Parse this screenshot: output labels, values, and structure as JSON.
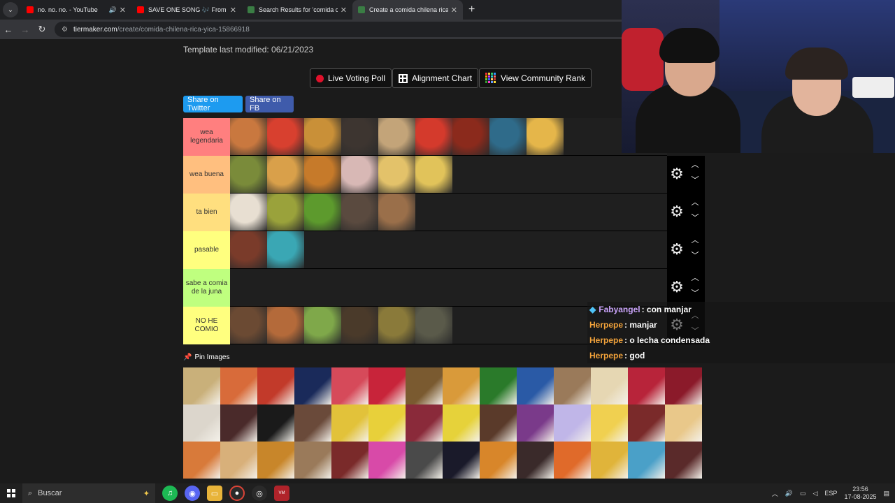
{
  "browser": {
    "tabs": [
      {
        "title": "no. no. no. - YouTube",
        "fav_color": "#ff0000",
        "active": false,
        "audio": true
      },
      {
        "title": "SAVE ONE SONG 🎶 From A to",
        "fav_color": "#ff0000",
        "active": false,
        "audio": false
      },
      {
        "title": "Search Results for 'comida chile",
        "fav_color": "#3a7d44",
        "active": false,
        "audio": false
      },
      {
        "title": "Create a comida chilena rica yica",
        "fav_color": "#3a7d44",
        "active": true,
        "audio": false
      }
    ],
    "url_host": "tiermaker.com",
    "url_path": "/create/comida-chilena-rica-yica-15866918"
  },
  "page": {
    "modified": "Template last modified: 06/21/2023",
    "buttons": {
      "live_poll": "Live Voting Poll",
      "alignment": "Alignment Chart",
      "community": "View Community Rank",
      "share_twitter": "Share on Twitter",
      "share_fb": "Share on FB"
    },
    "pin_images": "Pin Images"
  },
  "tiers": [
    {
      "label": "wea legendaria",
      "color": "#ff7f7f",
      "items": [
        "#c9783f",
        "#d8402f",
        "#c99038",
        "#3d3530",
        "#c3a479",
        "#d43a2c",
        "#8b2a1c",
        "#2f6b8a",
        "#e5b64a"
      ]
    },
    {
      "label": "wea buena",
      "color": "#ffbf7f",
      "items": [
        "#7a8b3a",
        "#d9a04a",
        "#c67a2a",
        "#d8b8b5",
        "#e3c26a",
        "#e1c35a"
      ]
    },
    {
      "label": "ta bien",
      "color": "#ffdf7f",
      "items": [
        "#e8dfd2",
        "#9aa23b",
        "#5d9a2d",
        "#5a4a3f",
        "#9a6f4a"
      ]
    },
    {
      "label": "pasable",
      "color": "#ffff7f",
      "items": [
        "#7a3b2a",
        "#3aa7b4"
      ]
    },
    {
      "label": "sabe a comia de la juna",
      "color": "#bfff7f",
      "items": []
    },
    {
      "label": "NO HE COMIO",
      "color": "#ffff7f",
      "items": [
        "#6b4a33",
        "#b46a3a",
        "#7fa84a",
        "#4a3a2a",
        "#8a7a3a",
        "#5a5a4a"
      ]
    }
  ],
  "pool": [
    "#c9b07a",
    "#d86b3a",
    "#c23a2a",
    "#1a2a5a",
    "#d64a5a",
    "#c8243a",
    "#7a5a30",
    "#d99a3a",
    "#2a7a2a",
    "#2a5aa6",
    "#9a7a5a",
    "#e6d7b3",
    "#b8243a",
    "#8b1a2a",
    "#dcd6cc",
    "#4a2a2a",
    "#1a1a1a",
    "#6a4a3a",
    "#e2c23a",
    "#e8d03a",
    "#8a2a3a",
    "#e6d23a",
    "#5a3a2a",
    "#7a3a8a",
    "#c0b6e8",
    "#f0d050",
    "#7a2a2a",
    "#e9c88a",
    "#d87a3a",
    "#d8b07a",
    "#c8862a",
    "#9a7a5a",
    "#7a2a2a",
    "#d84aa8",
    "#4a4a4a",
    "#1a1a2a",
    "#d8862a",
    "#3a2a2a",
    "#e06a2a",
    "#e0b43a",
    "#4aa0c8",
    "#5a2a2a"
  ],
  "chat": [
    {
      "user": "Fabyangel",
      "color": "#c8a2f8",
      "badge": true,
      "message": ": con manjar"
    },
    {
      "user": "Herpepe",
      "color": "#f2a23a",
      "badge": false,
      "message": ": manjar"
    },
    {
      "user": "Herpepe",
      "color": "#f2a23a",
      "badge": false,
      "message": ": o lecha condensada"
    },
    {
      "user": "Herpepe",
      "color": "#f2a23a",
      "badge": false,
      "message": ": god"
    }
  ],
  "taskbar": {
    "search_placeholder": "Buscar",
    "language": "ESP",
    "time": "23:56",
    "date": "17-08-2025"
  }
}
